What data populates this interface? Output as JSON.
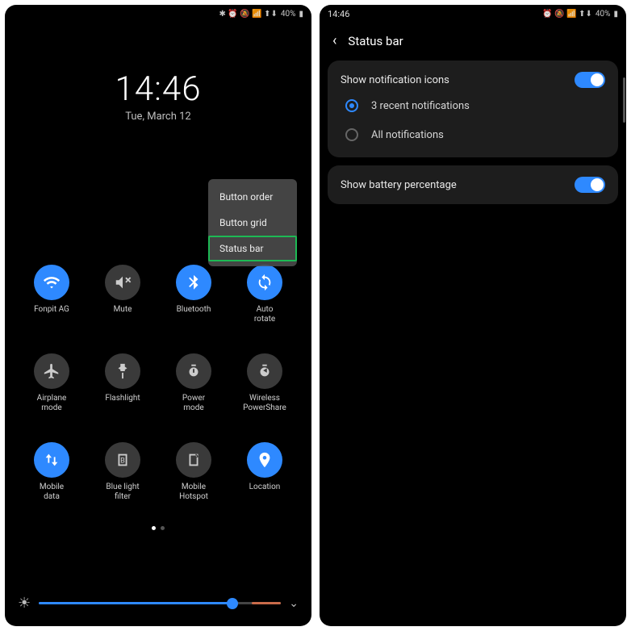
{
  "screen1": {
    "status": {
      "battery": "40%",
      "icons": "✱ ⏰ 🔕 📶 ⬆⬇"
    },
    "clock": {
      "time": "14:46",
      "date": "Tue, March 12"
    },
    "popup": {
      "item1": "Button order",
      "item2": "Button grid",
      "item3": "Status bar"
    },
    "tiles": [
      {
        "label": "Fonpit AG",
        "icon": "wifi",
        "on": true
      },
      {
        "label": "Mute",
        "icon": "mute",
        "on": false
      },
      {
        "label": "Bluetooth",
        "icon": "bt",
        "on": true
      },
      {
        "label": "Auto\nrotate",
        "icon": "rotate",
        "on": true
      },
      {
        "label": "Airplane\nmode",
        "icon": "plane",
        "on": false
      },
      {
        "label": "Flashlight",
        "icon": "flash",
        "on": false
      },
      {
        "label": "Power\nmode",
        "icon": "power",
        "on": false
      },
      {
        "label": "Wireless\nPowerShare",
        "icon": "share",
        "on": false
      },
      {
        "label": "Mobile\ndata",
        "icon": "data",
        "on": true
      },
      {
        "label": "Blue light\nfilter",
        "icon": "blue",
        "on": false
      },
      {
        "label": "Mobile\nHotspot",
        "icon": "hotspot",
        "on": false
      },
      {
        "label": "Location",
        "icon": "loc",
        "on": true
      }
    ]
  },
  "screen2": {
    "status": {
      "time": "14:46",
      "battery": "40%",
      "icons": "⏰ 🔕 📶 ⬆⬇"
    },
    "title": "Status bar",
    "showNotif": "Show notification icons",
    "opt1": "3 recent notifications",
    "opt2": "All notifications",
    "showBatt": "Show battery percentage"
  }
}
